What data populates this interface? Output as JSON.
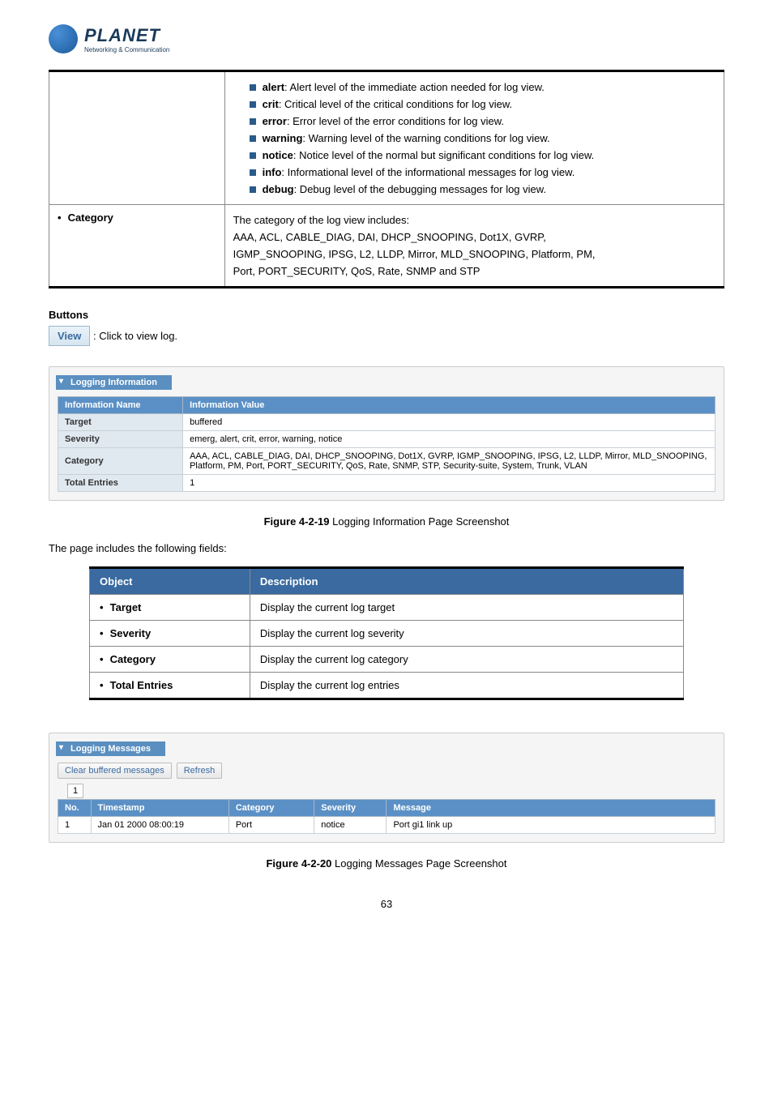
{
  "logo": {
    "main": "PLANET",
    "sub": "Networking & Communication"
  },
  "top_table": {
    "levels": [
      {
        "name": "alert",
        "desc": ": Alert level of the immediate action needed for log view."
      },
      {
        "name": "crit",
        "desc": ": Critical level of the critical conditions for log view."
      },
      {
        "name": "error",
        "desc": ": Error level of the error conditions for log view."
      },
      {
        "name": "warning",
        "desc": ": Warning level of the warning conditions for log view."
      },
      {
        "name": "notice",
        "desc": ": Notice level of the normal but significant conditions for log view."
      },
      {
        "name": "info",
        "desc": ": Informational level of the informational messages for log view."
      },
      {
        "name": "debug",
        "desc": ": Debug level of the debugging messages for log view."
      }
    ],
    "category_label": "Category",
    "category_lines": [
      "The category of the log view includes:",
      "AAA, ACL, CABLE_DIAG, DAI, DHCP_SNOOPING, Dot1X, GVRP,",
      "IGMP_SNOOPING, IPSG, L2, LLDP, Mirror, MLD_SNOOPING, Platform, PM,",
      "Port, PORT_SECURITY, QoS, Rate, SNMP and STP"
    ]
  },
  "buttons_heading": "Buttons",
  "view_button": "View",
  "view_desc": ": Click to view log.",
  "info_panel": {
    "title": "Logging Information",
    "headers": {
      "name": "Information Name",
      "value": "Information Value"
    },
    "rows": [
      {
        "name": "Target",
        "value": "buffered"
      },
      {
        "name": "Severity",
        "value": "emerg, alert, crit, error, warning, notice"
      },
      {
        "name": "Category",
        "value": "AAA, ACL, CABLE_DIAG, DAI, DHCP_SNOOPING, Dot1X, GVRP, IGMP_SNOOPING, IPSG, L2, LLDP, Mirror, MLD_SNOOPING, Platform, PM, Port, PORT_SECURITY, QoS, Rate, SNMP, STP, Security-suite, System, Trunk, VLAN"
      },
      {
        "name": "Total Entries",
        "value": "1"
      }
    ]
  },
  "caption1": {
    "bold": "Figure 4-2-19",
    "rest": " Logging Information Page Screenshot"
  },
  "fields_intro": "The page includes the following fields:",
  "obj_table": {
    "headers": {
      "object": "Object",
      "desc": "Description"
    },
    "rows": [
      {
        "object": "Target",
        "desc": "Display the current log target"
      },
      {
        "object": "Severity",
        "desc": "Display the current log severity"
      },
      {
        "object": "Category",
        "desc": "Display the current log category"
      },
      {
        "object": "Total Entries",
        "desc": "Display the current log entries"
      }
    ]
  },
  "msg_panel": {
    "title": "Logging Messages",
    "clear_btn": "Clear buffered messages",
    "refresh_btn": "Refresh",
    "page": "1",
    "headers": {
      "no": "No.",
      "ts": "Timestamp",
      "cat": "Category",
      "sev": "Severity",
      "msg": "Message"
    },
    "rows": [
      {
        "no": "1",
        "ts": "Jan 01 2000 08:00:19",
        "cat": "Port",
        "sev": "notice",
        "msg": "Port gi1 link up"
      }
    ]
  },
  "caption2": {
    "bold": "Figure 4-2-20",
    "rest": " Logging Messages Page Screenshot"
  },
  "page_number": "63"
}
